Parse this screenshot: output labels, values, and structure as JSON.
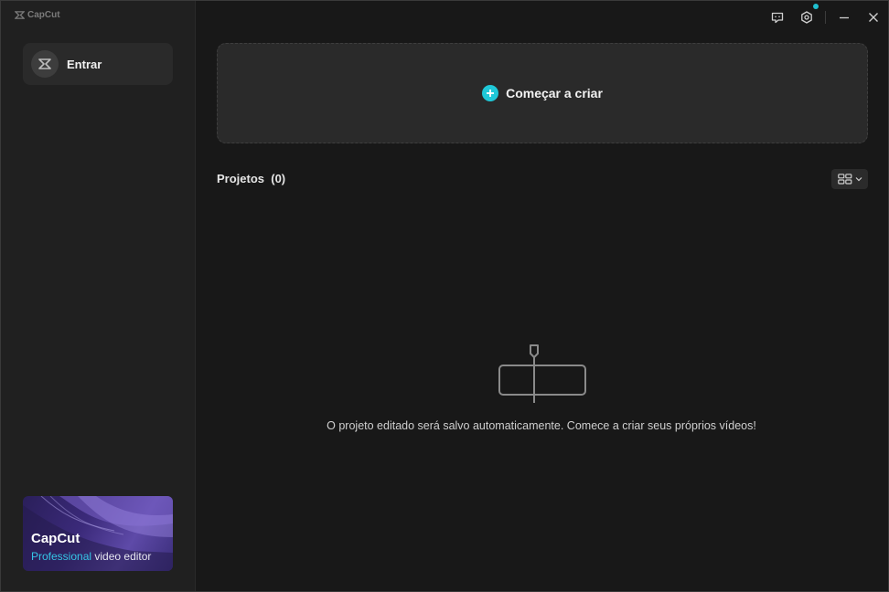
{
  "app": {
    "logo_text": "CapCut"
  },
  "sidebar": {
    "login_label": "Entrar",
    "promo": {
      "brand": "CapCut",
      "tagline_accent": "Professional",
      "tagline_rest": " video editor"
    }
  },
  "titlebar": {
    "icons": [
      "feedback-icon",
      "settings-icon",
      "minimize-icon",
      "close-icon"
    ],
    "accent_color": "#1fbfcf"
  },
  "main": {
    "create_label": "Começar a criar",
    "projects_title": "Projetos  (0)",
    "empty_message": "O projeto editado será salvo automaticamente. Comece a criar seus próprios vídeos!"
  }
}
